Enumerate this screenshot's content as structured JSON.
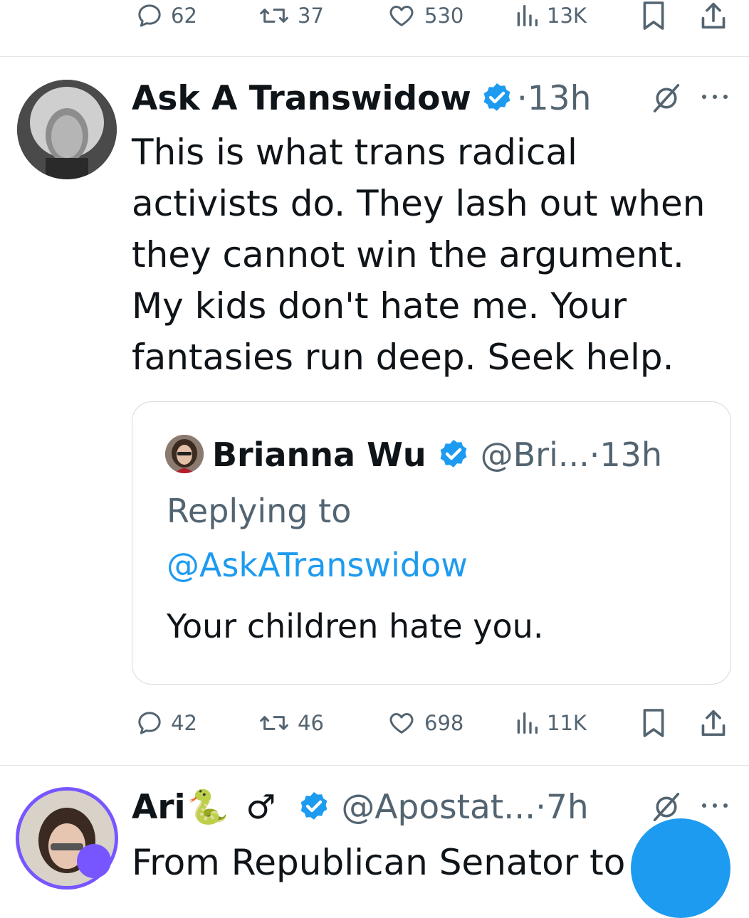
{
  "top_actions": {
    "replies": "62",
    "reposts": "37",
    "likes": "530",
    "views": "13K"
  },
  "tweet": {
    "author": "Ask A Transwidow",
    "sep": "·",
    "time": "13h",
    "lines": [
      "This is what trans radical",
      "activists do. They lash out when",
      "they cannot win the argument.",
      "My kids don't hate me. Your",
      "fantasies run deep. Seek help."
    ],
    "quote": {
      "author": "Brianna Wu",
      "handle": "@Bri...",
      "sep": "·",
      "time": "13h",
      "replying_label": "Replying to",
      "replying_handle": "@AskATranswidow",
      "text": "Your children hate you."
    },
    "actions": {
      "replies": "42",
      "reposts": "46",
      "likes": "698",
      "views": "11K"
    }
  },
  "next_tweet": {
    "author": "Ari",
    "emoji": "🐍",
    "symbol": "♂",
    "handle": "@Apostat...",
    "sep": "·",
    "time": "7h",
    "partial_text": "From Republican Senator to"
  },
  "colors": {
    "accent": "#1d9bf0",
    "text": "#0f1419",
    "muted": "#536471",
    "border": "#d3dade",
    "avatar_ring": "#7856ff"
  }
}
